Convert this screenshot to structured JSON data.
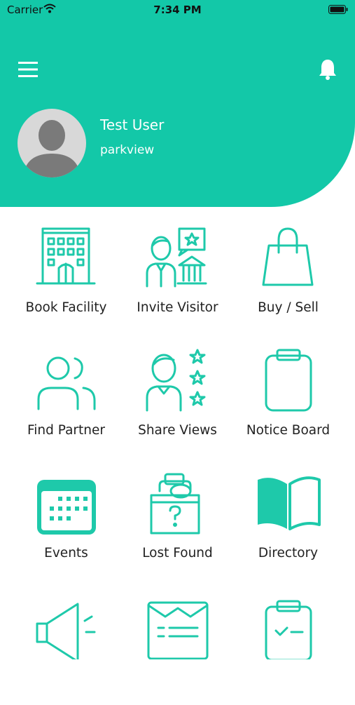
{
  "status_bar": {
    "carrier": "Carrier",
    "time": "7:34 PM"
  },
  "user": {
    "name": "Test User",
    "subtitle": "parkview"
  },
  "menu": [
    {
      "label": "Book Facility",
      "icon": "building-icon"
    },
    {
      "label": "Invite Visitor",
      "icon": "visitor-icon"
    },
    {
      "label": "Buy / Sell",
      "icon": "shopping-bag-icon"
    },
    {
      "label": "Find Partner",
      "icon": "people-icon"
    },
    {
      "label": "Share Views",
      "icon": "person-stars-icon"
    },
    {
      "label": "Notice Board",
      "icon": "clipboard-icon"
    },
    {
      "label": "Events",
      "icon": "calendar-icon"
    },
    {
      "label": "Lost Found",
      "icon": "lost-found-box-icon"
    },
    {
      "label": "Directory",
      "icon": "open-book-icon"
    },
    {
      "label": "",
      "icon": "megaphone-icon"
    },
    {
      "label": "",
      "icon": "document-icon"
    },
    {
      "label": "",
      "icon": "checklist-icon"
    }
  ],
  "colors": {
    "accent": "#13c8a8",
    "icon": "#1ec9aa"
  }
}
